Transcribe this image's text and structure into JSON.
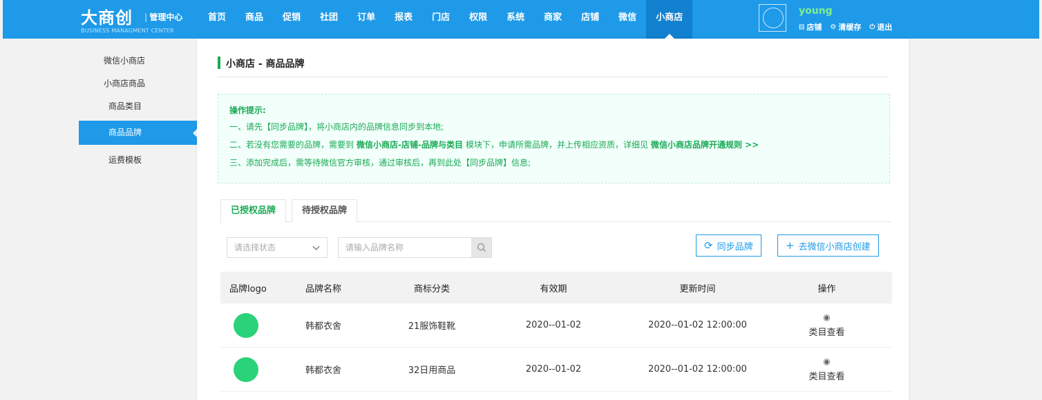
{
  "header": {
    "logo_main": "大商创",
    "logo_sub": "管理中心",
    "logo_en": "BUSINESS MANAGMENT CENTER",
    "nav": [
      "首页",
      "商品",
      "促销",
      "社团",
      "订单",
      "报表",
      "门店",
      "权限",
      "系统",
      "商家",
      "店铺",
      "微信",
      "小商店"
    ],
    "active_nav": "小商店",
    "user": {
      "name": "young",
      "links": [
        {
          "icon": "store-icon",
          "label": "店铺"
        },
        {
          "icon": "gear-icon",
          "label": "清缓存"
        },
        {
          "icon": "power-icon",
          "label": "退出"
        }
      ]
    }
  },
  "sidebar": {
    "items": [
      {
        "label": "微信小商店",
        "type": "group"
      },
      {
        "label": "小商店商品",
        "type": "group"
      },
      {
        "label": "商品类目",
        "type": "sub"
      },
      {
        "label": "商品品牌",
        "type": "sub",
        "active": true
      },
      {
        "label": "运费模板",
        "type": "sub"
      }
    ]
  },
  "main": {
    "title": "小商店 -  商品品牌",
    "tips": {
      "title": "操作提示:",
      "line1": "一、请先【同步品牌】，将小商店内的品牌信息同步到本地;",
      "line2_pre": "二、若没有您需要的品牌，需要到",
      "line2_link1": "微信小商店-店铺-品牌与类目",
      "line2_mid": "模块下，申请所需品牌，并上传相应资质，详细见",
      "line2_link2": "微信小商店品牌开通规则 >>",
      "line3": "三、添加完成后，需等待微信官方审核，通过审核后，再到此处【同步品牌】信息;"
    },
    "tabs": [
      {
        "label": "已授权品牌",
        "active": true
      },
      {
        "label": "待授权品牌",
        "active": false
      }
    ],
    "filter": {
      "status_placeholder": "请选择状态",
      "search_placeholder": "请输入品牌名称"
    },
    "buttons": {
      "sync": "同步品牌",
      "create": "去微信小商店创建"
    },
    "table": {
      "headers": [
        "品牌logo",
        "品牌名称",
        "商标分类",
        "有效期",
        "更新时间",
        "操作"
      ],
      "rows": [
        {
          "name": "韩都衣舍",
          "category": "21服饰鞋靴",
          "valid": "2020--01-02",
          "updated": "2020--01-02 12:00:00",
          "action": "类目查看"
        },
        {
          "name": "韩都衣舍",
          "category": "32日用商品",
          "valid": "2020--01-02",
          "updated": "2020--01-02 12:00:00",
          "action": "类目查看"
        }
      ]
    }
  },
  "colors": {
    "brand_blue": "#1e9ae8",
    "accent_green": "#1aaa55",
    "logo_green": "#2ad27a"
  }
}
